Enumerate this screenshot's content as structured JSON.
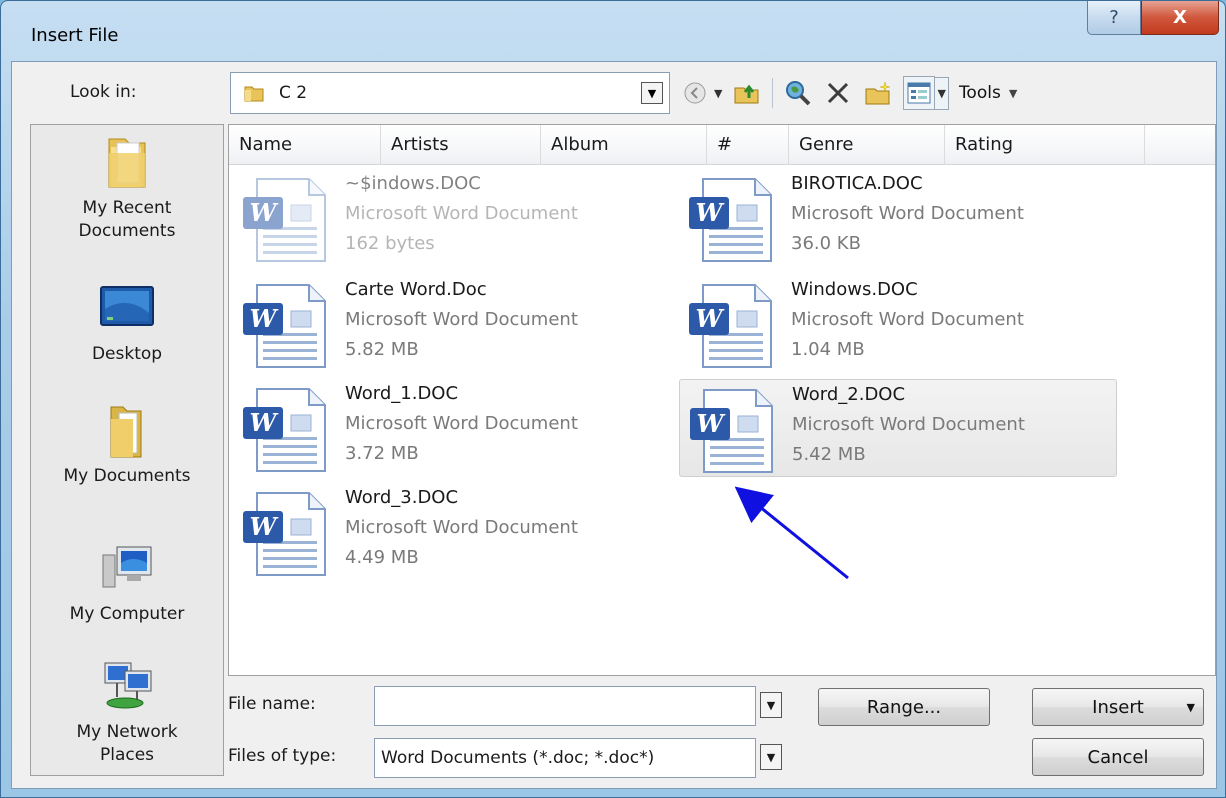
{
  "window": {
    "title": "Insert File",
    "help_glyph": "?",
    "close_glyph": "X"
  },
  "lookin": {
    "label": "Look in:",
    "label_accel": "i",
    "value": "C 2",
    "icon": "folder-icon"
  },
  "toolbar": {
    "back_icon": "back-arrow-icon",
    "up_icon": "up-folder-icon",
    "search_icon": "search-web-icon",
    "delete_icon": "delete-icon",
    "newfolder_icon": "new-folder-icon",
    "views_icon": "views-icon",
    "tools_label": "Tools",
    "tools_accel": "l"
  },
  "places": [
    {
      "label": "My Recent Documents",
      "icon": "recent-documents-icon"
    },
    {
      "label": "Desktop",
      "icon": "desktop-icon"
    },
    {
      "label": "My Documents",
      "icon": "my-documents-icon"
    },
    {
      "label": "My Computer",
      "icon": "my-computer-icon"
    },
    {
      "label": "My Network Places",
      "icon": "network-places-icon"
    }
  ],
  "columns": [
    "Name",
    "Artists",
    "Album",
    "#",
    "Genre",
    "Rating"
  ],
  "files": [
    {
      "name": "~$indows.DOC",
      "type": "Microsoft Word Document",
      "size": "162 bytes",
      "faded": true,
      "selected": false
    },
    {
      "name": "BIROTICA.DOC",
      "type": "Microsoft Word Document",
      "size": "36.0 KB",
      "faded": false,
      "selected": false
    },
    {
      "name": "Carte Word.Doc",
      "type": "Microsoft Word Document",
      "size": "5.82 MB",
      "faded": false,
      "selected": false
    },
    {
      "name": "Windows.DOC",
      "type": "Microsoft Word Document",
      "size": "1.04 MB",
      "faded": false,
      "selected": false
    },
    {
      "name": "Word_1.DOC",
      "type": "Microsoft Word Document",
      "size": "3.72 MB",
      "faded": false,
      "selected": false
    },
    {
      "name": "Word_2.DOC",
      "type": "Microsoft Word Document",
      "size": "5.42 MB",
      "faded": false,
      "selected": true
    },
    {
      "name": "Word_3.DOC",
      "type": "Microsoft Word Document",
      "size": "4.49 MB",
      "faded": false,
      "selected": false
    }
  ],
  "filename": {
    "label": "File name:",
    "value": ""
  },
  "filetype": {
    "label": "Files of type:",
    "value": "Word Documents (*.doc; *.doc*)"
  },
  "buttons": {
    "range": "Range...",
    "insert": "Insert",
    "cancel": "Cancel"
  },
  "colors": {
    "frame": "#a9cde9",
    "close": "#c23a1e",
    "annotation_arrow": "#1010e0"
  }
}
